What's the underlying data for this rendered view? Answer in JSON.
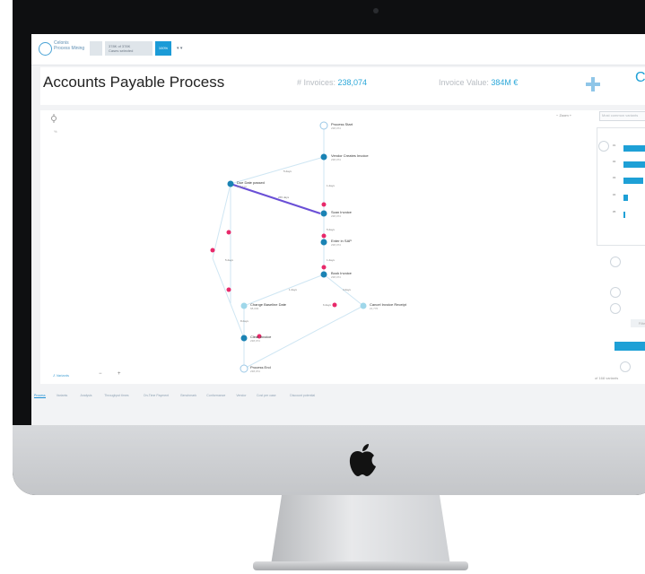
{
  "header": {
    "app_name_line1": "Celonis",
    "app_name_line2": "Process Mining",
    "pill1_line1": "378K of 378K",
    "pill1_line2": "Cases selected",
    "pill_blue": "100%"
  },
  "title": "Accounts Payable Process",
  "kpis": {
    "invoices_label": "# Invoices: ",
    "invoices_value": "238,074",
    "value_label": "Invoice Value: ",
    "value_value": "384M €",
    "cut_letter": "C"
  },
  "process_map": {
    "nodes": [
      {
        "label": "Process Start",
        "sub": "238,074"
      },
      {
        "label": "Vendor Creates Invoice",
        "sub": "238,074"
      },
      {
        "label": "Due Date passed",
        "sub": "142,113"
      },
      {
        "label": "Scan Invoice",
        "sub": "238,074"
      },
      {
        "label": "Enter in SAP",
        "sub": "238,074"
      },
      {
        "label": "Book Invoice",
        "sub": "238,074"
      },
      {
        "label": "Change Baseline Date",
        "sub": "68,003"
      },
      {
        "label": "Cancel Invoice Receipt",
        "sub": "21,776"
      },
      {
        "label": "Clear Invoice",
        "sub": "238,074"
      },
      {
        "label": "Process End",
        "sub": "238,074"
      }
    ],
    "edge_labels": [
      "5 days",
      "1 days",
      "5 days",
      "1 days",
      "1 days",
      "4 days",
      "6 days",
      "8 days",
      "5 days",
      "265 days"
    ]
  },
  "sidebar": {
    "zoom_label": "Zoom",
    "search_placeholder": "Most common variants",
    "filter_label": "Filter on",
    "cases_text": "of 168 variants",
    "variants_label": "Variants"
  },
  "histogram": {
    "rows": [
      {
        "label": "#1",
        "value": 0.95
      },
      {
        "label": "#2",
        "value": 0.92
      },
      {
        "label": "#3",
        "value": 0.55
      },
      {
        "label": "#4",
        "value": 0.12
      },
      {
        "label": "#5",
        "value": 0.06
      }
    ]
  },
  "tabs": [
    "Process",
    "Variants",
    "Analysis",
    "Throughput times",
    "On-Time Payment",
    "Benchmark",
    "Conformance",
    "Vendor",
    "Cost per case",
    "Discount potential"
  ],
  "colors": {
    "accent": "#1ea0d6",
    "path": "#6a4fd6",
    "event": "#e8296a"
  }
}
